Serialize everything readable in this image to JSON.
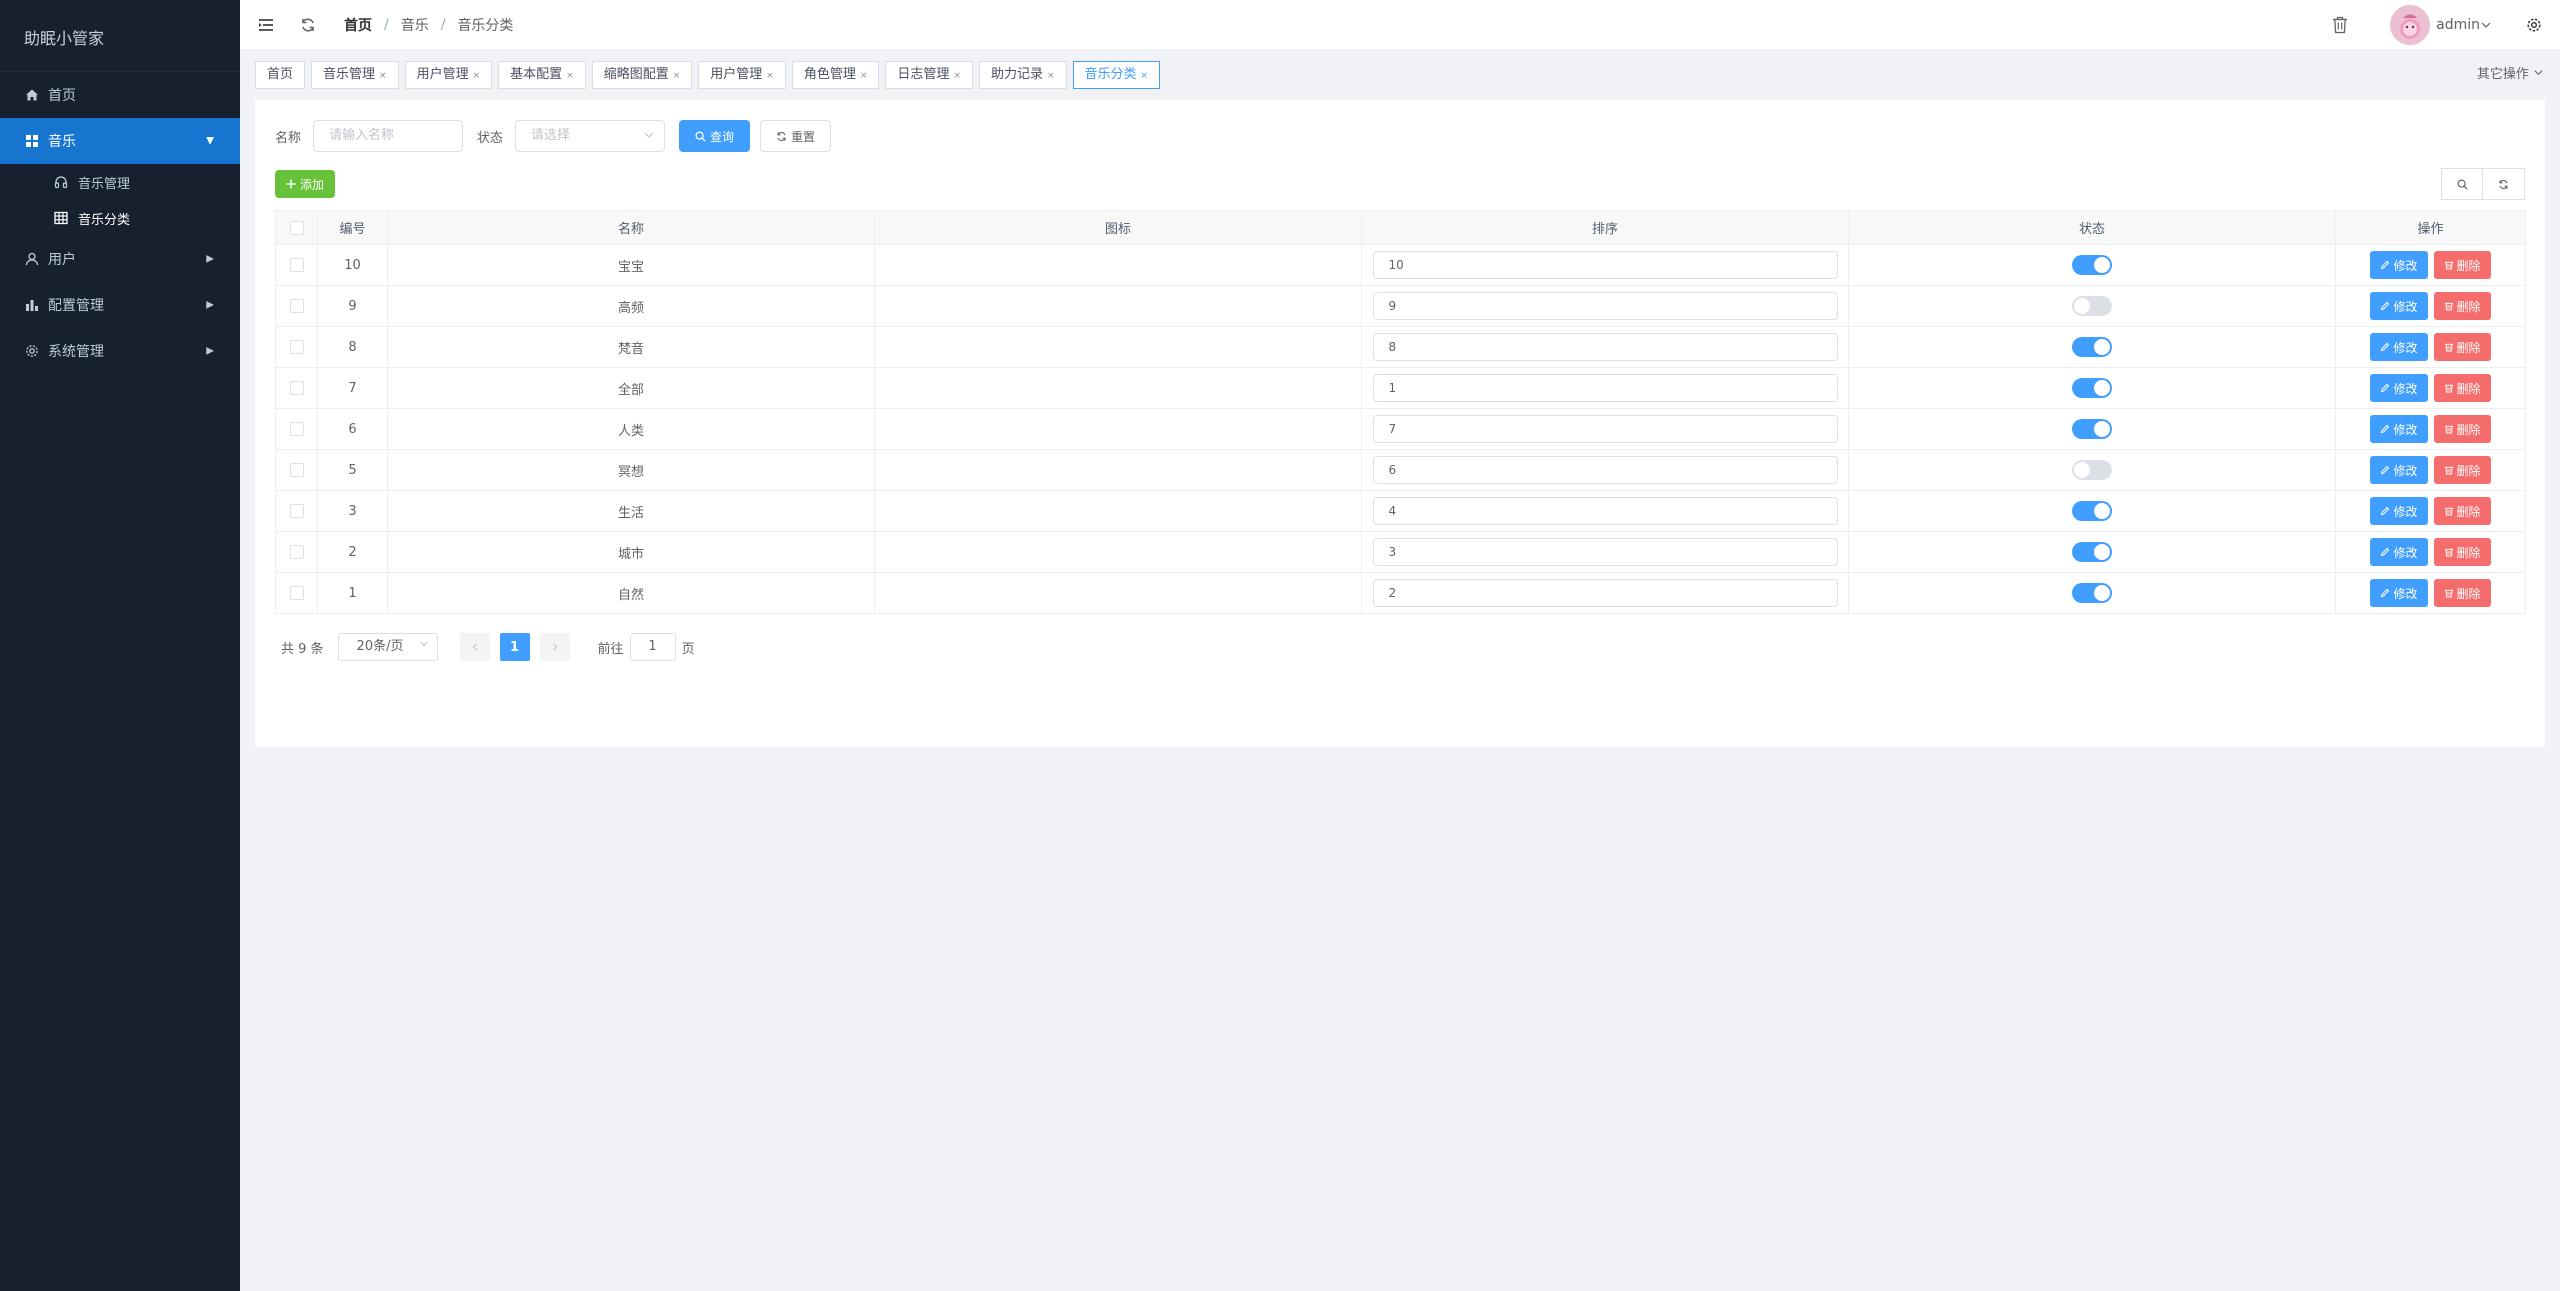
{
  "app": {
    "title": "助眠小管家"
  },
  "sidebar": {
    "items": [
      {
        "label": "首页",
        "icon": "home-icon"
      },
      {
        "label": "音乐",
        "icon": "grid-icon"
      },
      {
        "label": "用户",
        "icon": "user-icon"
      },
      {
        "label": "配置管理",
        "icon": "chart-icon"
      },
      {
        "label": "系统管理",
        "icon": "gear-icon"
      }
    ],
    "subitems": [
      {
        "label": "音乐管理",
        "icon": "headphones-icon"
      },
      {
        "label": "音乐分类",
        "icon": "table-icon"
      }
    ]
  },
  "header": {
    "breadcrumb": [
      "首页",
      "音乐",
      "音乐分类"
    ],
    "username": "admin"
  },
  "tags": {
    "items": [
      "首页",
      "音乐管理",
      "用户管理",
      "基本配置",
      "缩略图配置",
      "用户管理",
      "角色管理",
      "日志管理",
      "助力记录",
      "音乐分类"
    ],
    "close": "×",
    "other_ops": "其它操作"
  },
  "search": {
    "name_label": "名称",
    "name_placeholder": "请输入名称",
    "status_label": "状态",
    "status_placeholder": "请选择",
    "query_label": "查询",
    "reset_label": "重置"
  },
  "toolbar": {
    "add_label": "添加"
  },
  "table": {
    "columns": [
      "",
      "编号",
      "名称",
      "图标",
      "排序",
      "状态",
      "操作"
    ],
    "edit_label": "修改",
    "delete_label": "删除",
    "rows": [
      {
        "id": "10",
        "name": "宝宝",
        "sort": "10",
        "status": true
      },
      {
        "id": "9",
        "name": "高频",
        "sort": "9",
        "status": false
      },
      {
        "id": "8",
        "name": "梵音",
        "sort": "8",
        "status": true
      },
      {
        "id": "7",
        "name": "全部",
        "sort": "1",
        "status": true
      },
      {
        "id": "6",
        "name": "人类",
        "sort": "7",
        "status": true
      },
      {
        "id": "5",
        "name": "冥想",
        "sort": "6",
        "status": false
      },
      {
        "id": "3",
        "name": "生活",
        "sort": "4",
        "status": true
      },
      {
        "id": "2",
        "name": "城市",
        "sort": "3",
        "status": true
      },
      {
        "id": "1",
        "name": "自然",
        "sort": "2",
        "status": true
      }
    ]
  },
  "pagination": {
    "total": "共 9 条",
    "page_size": "20条/页",
    "current": "1",
    "goto_label": "前往",
    "goto_value": "1",
    "page_suffix": "页"
  },
  "colors": {
    "sidebar_bg": "#16202f",
    "active_menu": "#1676cf",
    "primary": "#409eff",
    "success": "#67c23a",
    "danger": "#f56c6c"
  }
}
